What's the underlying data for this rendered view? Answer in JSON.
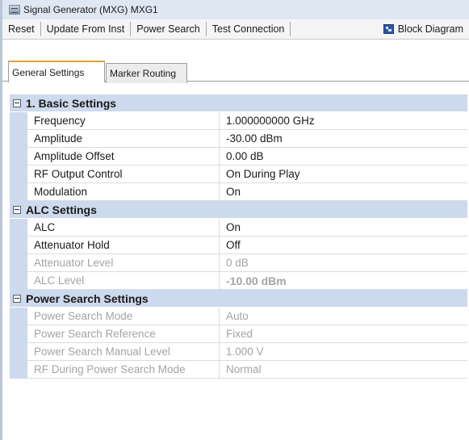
{
  "window": {
    "title": "Signal Generator (MXG) MXG1"
  },
  "toolbar": {
    "reset": "Reset",
    "update_from_inst": "Update From Inst",
    "power_search": "Power Search",
    "test_connection": "Test Connection",
    "block_diagram": "Block Diagram"
  },
  "tabs": [
    {
      "label": "General Settings",
      "active": true
    },
    {
      "label": "Marker Routing",
      "active": false
    }
  ],
  "sections": [
    {
      "title": "1. Basic Settings",
      "rows": [
        {
          "name": "Frequency",
          "value": "1.000000000 GHz"
        },
        {
          "name": "Amplitude",
          "value": "-30.00 dBm"
        },
        {
          "name": "Amplitude Offset",
          "value": "0.00 dB"
        },
        {
          "name": "RF Output Control",
          "value": "On During Play"
        },
        {
          "name": "Modulation",
          "value": "On"
        }
      ]
    },
    {
      "title": "ALC Settings",
      "rows": [
        {
          "name": "ALC",
          "value": "On"
        },
        {
          "name": "Attenuator Hold",
          "value": "Off"
        },
        {
          "name": "Attenuator Level",
          "value": "0 dB"
        },
        {
          "name": "ALC Level",
          "value": "-10.00 dBm"
        }
      ]
    },
    {
      "title": "Power Search Settings",
      "rows": [
        {
          "name": "Power Search Mode",
          "value": "Auto"
        },
        {
          "name": "Power Search Reference",
          "value": "Fixed"
        },
        {
          "name": "Power Search Manual Level",
          "value": "1.000 V"
        },
        {
          "name": "RF During Power Search Mode",
          "value": "Normal"
        }
      ]
    }
  ],
  "colors": {
    "section_header": "#cdd9ec",
    "disabled_text": "#a4a4a4",
    "active_tab_accent": "#e6a23c"
  }
}
